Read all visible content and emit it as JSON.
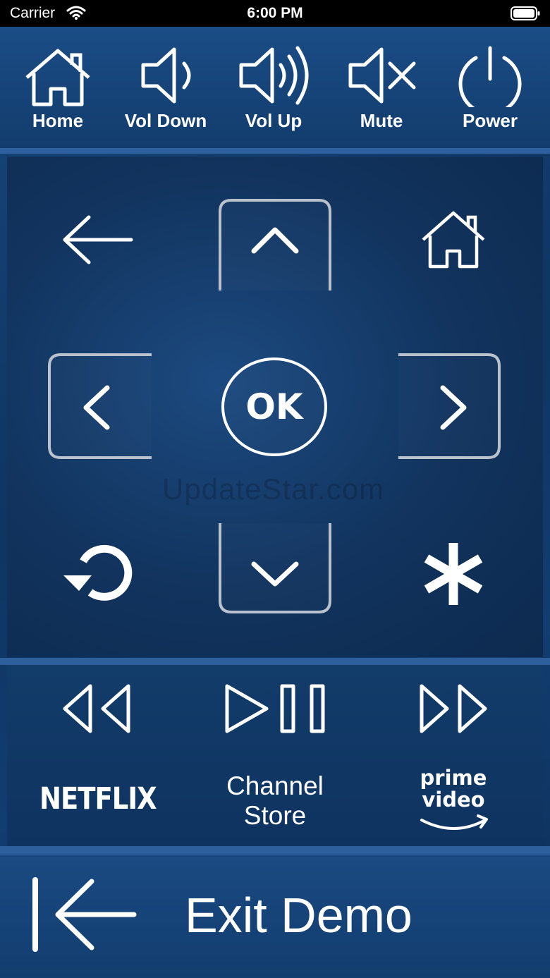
{
  "status_bar": {
    "carrier": "Carrier",
    "time": "6:00 PM"
  },
  "top_bar": {
    "home_label": "Home",
    "vol_down_label": "Vol Down",
    "vol_up_label": "Vol Up",
    "mute_label": "Mute",
    "power_label": "Power"
  },
  "dpad": {
    "ok_label": "OK",
    "watermark": "UpdateStar.com"
  },
  "media": {
    "netflix_label": "NETFLIX",
    "channel_store_line1": "Channel",
    "channel_store_line2": "Store",
    "prime_line1": "prime",
    "prime_line2": "video"
  },
  "exit": {
    "label": "Exit Demo"
  },
  "icons": {
    "home": "home-icon",
    "vol_down": "volume-down-icon",
    "vol_up": "volume-up-icon",
    "mute": "mute-icon",
    "power": "power-icon",
    "back": "back-arrow-icon",
    "up": "chevron-up-icon",
    "roku_home": "home-icon",
    "left": "chevron-left-icon",
    "right": "chevron-right-icon",
    "replay": "replay-icon",
    "down": "chevron-down-icon",
    "options": "asterisk-icon",
    "rewind": "rewind-icon",
    "play_pause": "play-pause-icon",
    "fast_forward": "fast-forward-icon",
    "exit": "exit-arrow-icon"
  },
  "colors": {
    "background": "#123d70",
    "button_border": "#b9c1cc",
    "text": "#ffffff"
  }
}
